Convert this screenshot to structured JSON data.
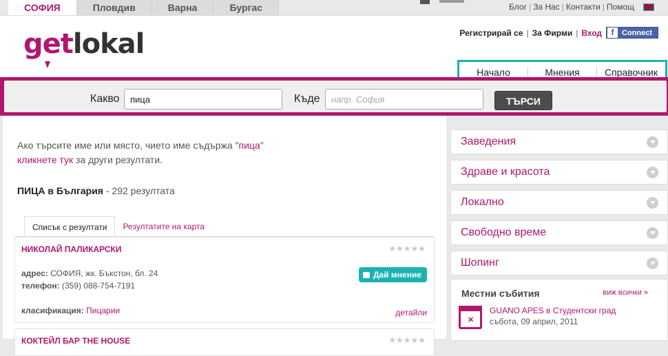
{
  "cities": [
    {
      "label": "СОФИЯ",
      "active": true
    },
    {
      "label": "Пловдив",
      "active": false
    },
    {
      "label": "Варна",
      "active": false
    },
    {
      "label": "Бургас",
      "active": false
    }
  ],
  "toplinks": {
    "blog": "Блог",
    "about": "За Нас",
    "contacts": "Контакти",
    "help": "Помощ"
  },
  "logo": {
    "part1": "get",
    "part2": "lokal"
  },
  "account": {
    "register": "Регистрирай се",
    "business": "За Фирми",
    "login": "Вход",
    "fb": "Connect"
  },
  "nav": {
    "home": "Начало",
    "reviews": "Мнения",
    "directory": "Справочник"
  },
  "search": {
    "what_label": "Какво",
    "what_value": "пица",
    "where_label": "Къде",
    "where_placeholder": "напр. София",
    "button": "ТЪРСИ"
  },
  "intro": {
    "line1_a": "Ако търсите име или място, чието име съдържа \"",
    "line1_term": "пица",
    "line1_b": "\"",
    "line2_link": "кликнете тук",
    "line2_rest": " за други резултати."
  },
  "results": {
    "query": "ПИЦА в България",
    "count_text": " - 292 резултата"
  },
  "tabs": {
    "list": "Списък с резултати",
    "map": "Резултатите на карта"
  },
  "listings": [
    {
      "name": "НИКОЛАЙ ПАЛИКАРСКИ",
      "address_label": "адрес:",
      "address": " СОФИЯ, жк. Бъкстон, бл. 24",
      "phone_label": "телефон:",
      "phone": " (359) 088-754-7191",
      "class_label": "класификация:",
      "classification": "Пицарии",
      "review_btn": "Дай мнение",
      "details": "детайли",
      "stars": "★★★★★"
    },
    {
      "name": "КОКТЕЙЛ БАР THE HOUSE",
      "stars": "★★★★★"
    }
  ],
  "sidebar": [
    "Заведения",
    "Здраве и красота",
    "Локално",
    "Свободно време",
    "Шопинг"
  ],
  "events": {
    "title": "Местни събития",
    "see_all": "виж всички »",
    "event_name": "GUANO APES в Студентски град",
    "event_date": "събота, 09 април, 2011"
  },
  "colors": {
    "brand": "#b0176f",
    "accent": "#1bb3b0"
  }
}
